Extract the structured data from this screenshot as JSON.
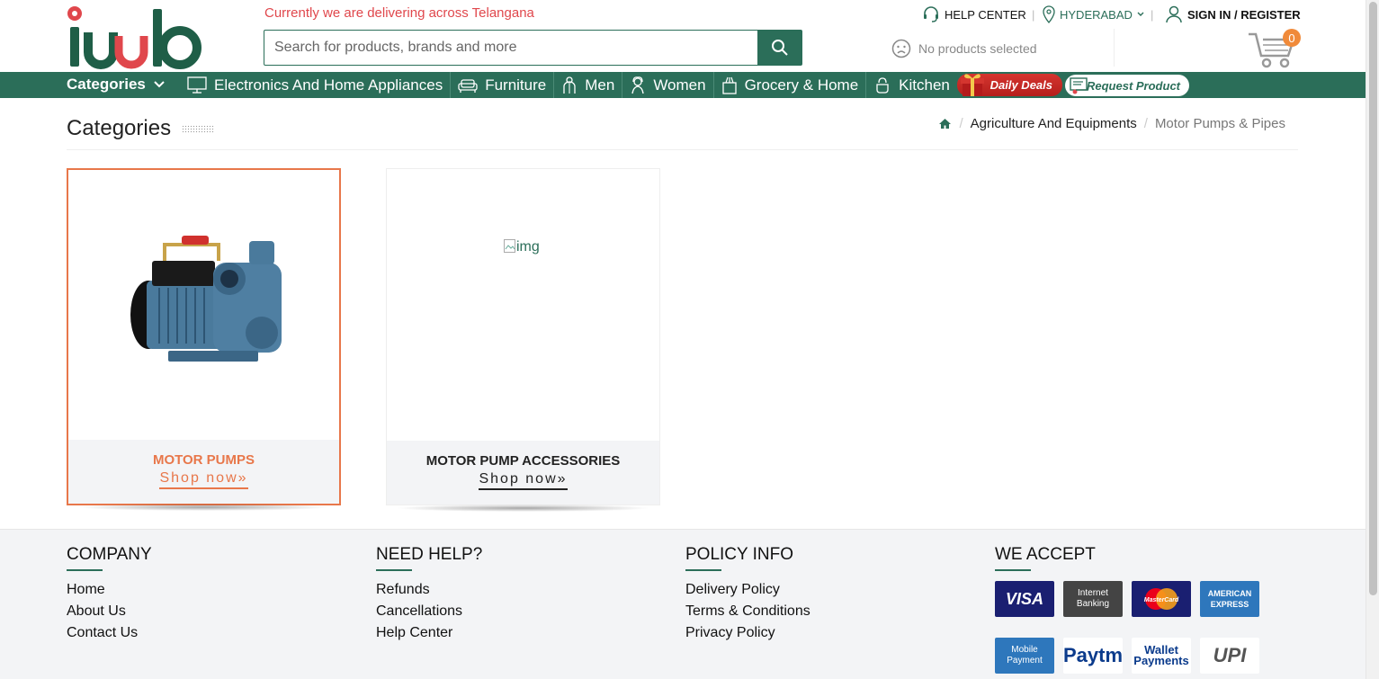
{
  "header": {
    "logo_text": "ihub",
    "delivery_notice": "Currently we are delivering across Telangana",
    "search_placeholder": "Search for products, brands and more",
    "help_center": "HELP CENTER",
    "city": "HYDERABAD",
    "sign_in": "SIGN IN / REGISTER",
    "no_products": "No products selected",
    "cart_count": "0"
  },
  "nav": {
    "categories": "Categories",
    "items": [
      {
        "label": "Electronics And Home Appliances",
        "icon": "monitor-icon"
      },
      {
        "label": "Furniture",
        "icon": "sofa-icon"
      },
      {
        "label": "Men",
        "icon": "man-icon"
      },
      {
        "label": "Women",
        "icon": "woman-icon"
      },
      {
        "label": "Grocery & Home",
        "icon": "grocery-bag-icon"
      },
      {
        "label": "Kitchen",
        "icon": "kitchen-icon"
      }
    ],
    "daily_deals": "Daily Deals",
    "request_product": "Request Product"
  },
  "page": {
    "title": "Categories",
    "breadcrumb": {
      "parent": "Agriculture And Equipments",
      "current": "Motor Pumps & Pipes"
    }
  },
  "cards": [
    {
      "name": "MOTOR PUMPS",
      "cta": "Shop now»",
      "selected": true
    },
    {
      "name": "MOTOR PUMP ACCESSORIES",
      "cta": "Shop now»",
      "image_alt": "img",
      "selected": false
    }
  ],
  "footer": {
    "company": {
      "heading": "COMPANY",
      "links": [
        "Home",
        "About Us",
        "Contact Us"
      ]
    },
    "help": {
      "heading": "NEED HELP?",
      "links": [
        "Refunds",
        "Cancellations",
        "Help Center"
      ]
    },
    "policy": {
      "heading": "POLICY INFO",
      "links": [
        "Delivery Policy",
        "Terms & Conditions",
        "Privacy Policy"
      ]
    },
    "accept": {
      "heading": "WE ACCEPT",
      "methods": [
        {
          "label": "VISA",
          "color": "#1a1f71"
        },
        {
          "label": "Internet Banking",
          "color": "#444444"
        },
        {
          "label": "MasterCard",
          "color": "#1a1f71"
        },
        {
          "label": "AMERICAN EXPRESS",
          "color": "#2e77bc"
        },
        {
          "label": "Mobile Payment",
          "color": "#2e77bc"
        },
        {
          "label": "Paytm",
          "color": "#ffffff"
        },
        {
          "label": "Wallet Payments",
          "color": "#ffffff"
        },
        {
          "label": "UPI",
          "color": "#ffffff"
        }
      ]
    }
  },
  "colors": {
    "brand_green": "#2b6e59",
    "accent_orange": "#e8774a",
    "notice_red": "#e0474c"
  }
}
